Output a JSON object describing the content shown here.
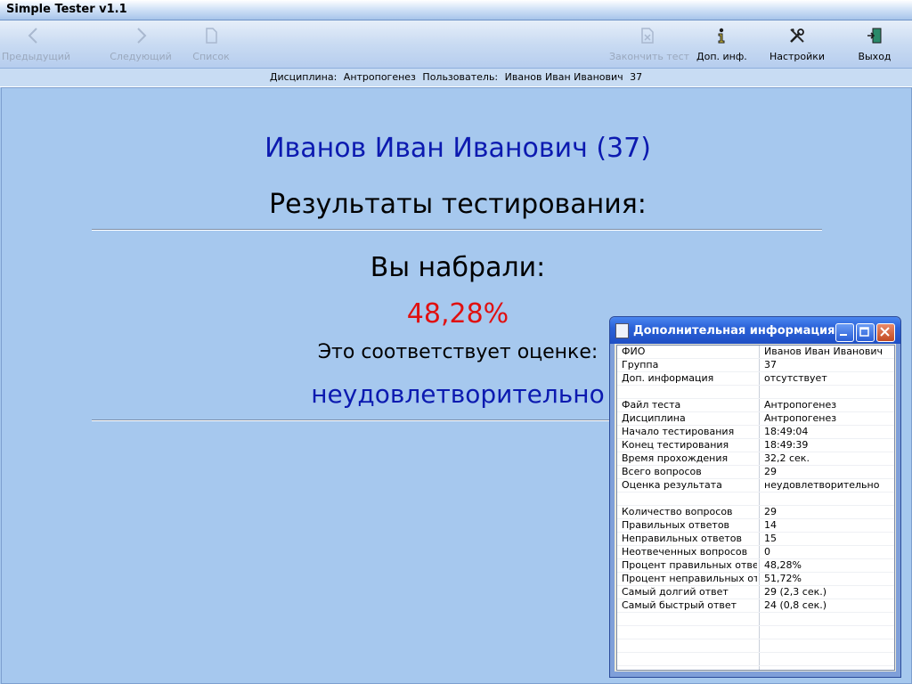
{
  "window": {
    "title": "Simple Tester v1.1"
  },
  "toolbar": {
    "prev": {
      "label": "Предыдущий",
      "icon": "arrow-left-icon"
    },
    "next": {
      "label": "Следующий",
      "icon": "arrow-right-icon"
    },
    "list": {
      "label": "Список",
      "icon": "document-icon"
    },
    "finish": {
      "label": "Закончить тест",
      "icon": "finish-test-icon"
    },
    "info": {
      "label": "Доп. инф.",
      "icon": "info-icon"
    },
    "settings": {
      "label": "Настройки",
      "icon": "tools-icon"
    },
    "exit": {
      "label": "Выход",
      "icon": "exit-door-icon"
    }
  },
  "infobar": {
    "discipline_label": "Дисциплина:",
    "discipline": "Антропогенез",
    "user_label": "Пользователь:",
    "user": "Иванов Иван Иванович",
    "group": "37"
  },
  "result": {
    "student": "Иванов Иван Иванович (37)",
    "title": "Результаты тестирования:",
    "scored_label": "Вы набрали:",
    "score": "48,28%",
    "grade_label": "Это соответствует оценке:",
    "grade": "неудовлетворительно"
  },
  "dialog": {
    "title": "Дополнительная информация",
    "rows": [
      {
        "k": "ФИО",
        "v": "Иванов Иван Иванович"
      },
      {
        "k": "Группа",
        "v": "37"
      },
      {
        "k": "Доп. информация",
        "v": "отсутствует"
      },
      {
        "k": "",
        "v": ""
      },
      {
        "k": "Файл теста",
        "v": " Антропогенез"
      },
      {
        "k": "Дисциплина",
        "v": " Антропогенез"
      },
      {
        "k": "Начало тестирования",
        "v": "18:49:04"
      },
      {
        "k": "Конец тестирования",
        "v": "18:49:39"
      },
      {
        "k": "Время прохождения",
        "v": "32,2 сек."
      },
      {
        "k": "Всего вопросов",
        "v": "29"
      },
      {
        "k": "Оценка результата",
        "v": "неудовлетворительно"
      },
      {
        "k": "",
        "v": ""
      },
      {
        "k": "Количество вопросов",
        "v": "29"
      },
      {
        "k": "Правильных ответов",
        "v": "14"
      },
      {
        "k": "Неправильных ответов",
        "v": "15"
      },
      {
        "k": "Неотвеченных вопросов",
        "v": "0"
      },
      {
        "k": "Процент правильных ответов",
        "v": "48,28%"
      },
      {
        "k": "Процент неправильных отв...",
        "v": "51,72%"
      },
      {
        "k": "Самый долгий ответ",
        "v": "29 (2,3 сек.)"
      },
      {
        "k": "Самый быстрый ответ",
        "v": "24 (0,8 сек.)"
      },
      {
        "k": "",
        "v": ""
      },
      {
        "k": "",
        "v": ""
      },
      {
        "k": "",
        "v": ""
      },
      {
        "k": "",
        "v": ""
      },
      {
        "k": "",
        "v": ""
      },
      {
        "k": "",
        "v": ""
      }
    ]
  },
  "colors": {
    "accent": "#0c1ab0",
    "score": "#e01010",
    "background": "#a6c8ee"
  }
}
